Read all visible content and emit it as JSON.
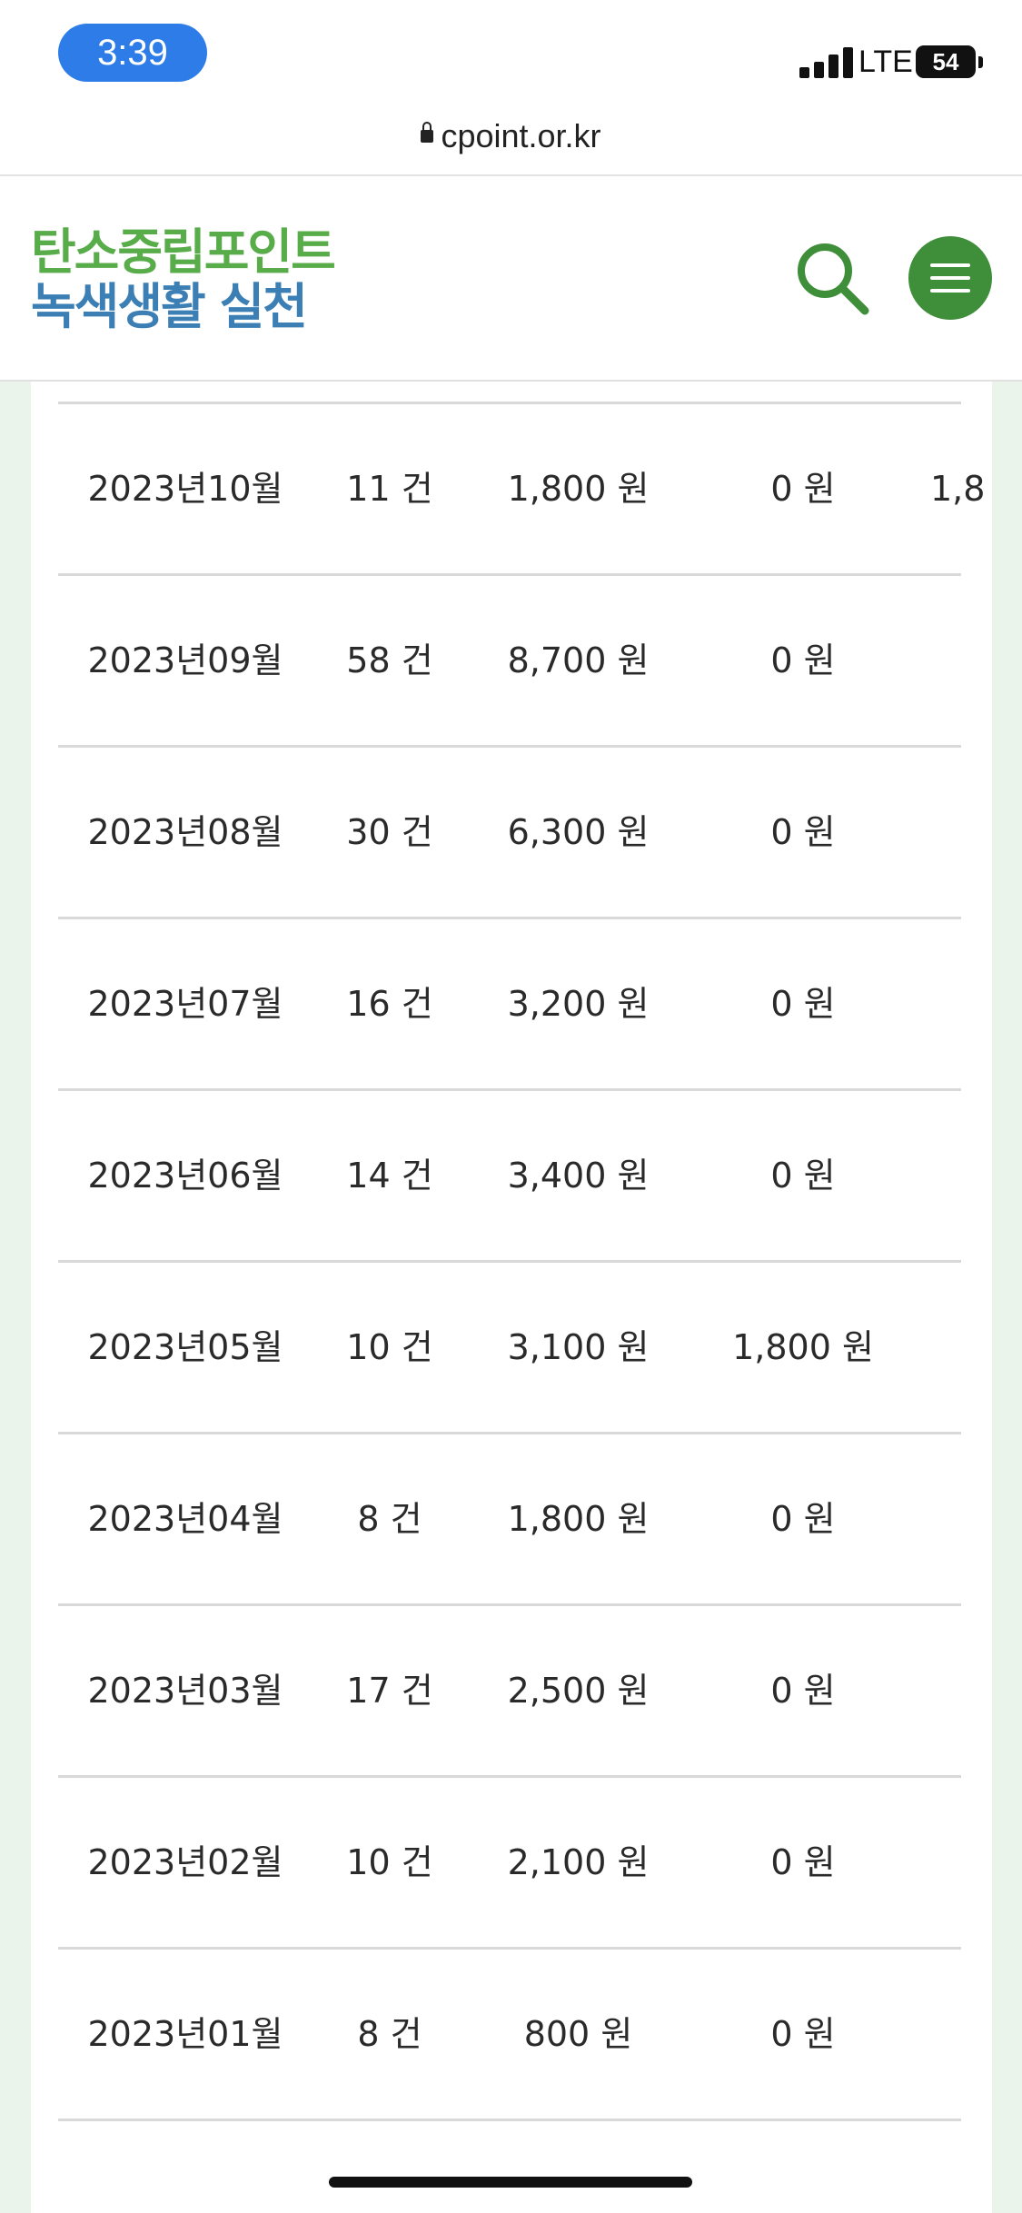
{
  "status_bar": {
    "time": "3:39",
    "network": "LTE",
    "battery": "54"
  },
  "browser": {
    "url": "cpoint.or.kr"
  },
  "header": {
    "logo_line1": "탄소중립포인트",
    "logo_line2": "녹색생활 실천",
    "search_icon": "search-icon",
    "menu_icon": "hamburger-menu-icon"
  },
  "colors": {
    "time_pill": "#2d7ce8",
    "logo_green": "#58ad4a",
    "logo_blue": "#3c7fb5",
    "menu_button": "#3f8e3a",
    "page_background": "#ebf4ea"
  },
  "table": {
    "rows": [
      {
        "month": "2023년10월",
        "count": "11 건",
        "earned": "1,800 원",
        "used": "0 원",
        "extra": "1,8"
      },
      {
        "month": "2023년09월",
        "count": "58 건",
        "earned": "8,700 원",
        "used": "0 원",
        "extra": ""
      },
      {
        "month": "2023년08월",
        "count": "30 건",
        "earned": "6,300 원",
        "used": "0 원",
        "extra": ""
      },
      {
        "month": "2023년07월",
        "count": "16 건",
        "earned": "3,200 원",
        "used": "0 원",
        "extra": ""
      },
      {
        "month": "2023년06월",
        "count": "14 건",
        "earned": "3,400 원",
        "used": "0 원",
        "extra": ""
      },
      {
        "month": "2023년05월",
        "count": "10 건",
        "earned": "3,100 원",
        "used": "1,800 원",
        "extra": ""
      },
      {
        "month": "2023년04월",
        "count": "8 건",
        "earned": "1,800 원",
        "used": "0 원",
        "extra": ""
      },
      {
        "month": "2023년03월",
        "count": "17 건",
        "earned": "2,500 원",
        "used": "0 원",
        "extra": ""
      },
      {
        "month": "2023년02월",
        "count": "10 건",
        "earned": "2,100 원",
        "used": "0 원",
        "extra": ""
      },
      {
        "month": "2023년01월",
        "count": "8 건",
        "earned": "800 원",
        "used": "0 원",
        "extra": ""
      }
    ]
  }
}
